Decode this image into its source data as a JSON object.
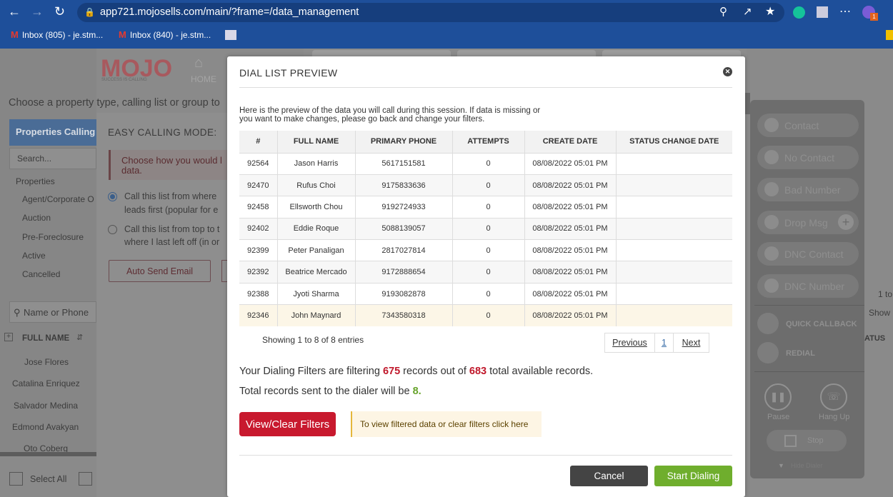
{
  "browser": {
    "url": "app721.mojosells.com/main/?frame=/data_management",
    "bookmarks": [
      {
        "label": "Inbox (805) - je.stm..."
      },
      {
        "label": "Inbox (840) - je.stm..."
      }
    ]
  },
  "background": {
    "brand": "MOJO",
    "brand_tagline": "SUCCESS IS CALLING",
    "home_label": "HOME",
    "choose_text": "Choose a property type, calling list or group to",
    "sidebar_title": "Properties Calling",
    "search_placeholder": "Search...",
    "properties_label": "Properties",
    "property_items": [
      "Agent/Corporate O",
      "Auction",
      "Pre-Foreclosure",
      "Active",
      "Cancelled"
    ],
    "name_phone_placeholder": "Name or Phone",
    "full_name_header": "FULL NAME",
    "names": [
      "Jose Flores",
      "Catalina Enriquez",
      "Salvador Medina",
      "Edmond Avakyan",
      "Oto Coberg"
    ],
    "select_all": "Select All",
    "easy_calling_title": "EASY CALLING MODE:",
    "choose_how": "Choose how you would l",
    "choose_how2": "data.",
    "option1a": "Call this list from where",
    "option1b": "leads first (popular for e",
    "option2a": "Call this list from top to t",
    "option2b": "where I last left off (in or",
    "auto_send_email": "Auto Send Email",
    "right_partial_1": "1 to",
    "right_partial_2": "Show",
    "right_partial_3": "ATUS"
  },
  "dialer": {
    "buttons": [
      "Contact",
      "No Contact",
      "Bad Number",
      "Drop Msg",
      "DNC Contact",
      "DNC Number"
    ],
    "quick_callback": "QUICK CALLBACK",
    "redial": "REDIAL",
    "pause": "Pause",
    "hang_up": "Hang Up",
    "stop": "Stop",
    "hide_dialer": "Hide Dialer"
  },
  "modal": {
    "title": "DIAL LIST PREVIEW",
    "intro": "Here is the preview of the data you will call during this session. If data is missing or you want to make changes, please go back and change your filters.",
    "columns": [
      "#",
      "FULL NAME",
      "PRIMARY PHONE",
      "ATTEMPTS",
      "CREATE DATE",
      "STATUS CHANGE DATE"
    ],
    "rows": [
      [
        "92564",
        "Jason Harris",
        "5617151581",
        "0",
        "08/08/2022 05:01 PM",
        ""
      ],
      [
        "92470",
        "Rufus Choi",
        "9175833636",
        "0",
        "08/08/2022 05:01 PM",
        ""
      ],
      [
        "92458",
        "Ellsworth Chou",
        "9192724933",
        "0",
        "08/08/2022 05:01 PM",
        ""
      ],
      [
        "92402",
        "Eddie Roque",
        "5088139057",
        "0",
        "08/08/2022 05:01 PM",
        ""
      ],
      [
        "92399",
        "Peter Panaligan",
        "2817027814",
        "0",
        "08/08/2022 05:01 PM",
        ""
      ],
      [
        "92392",
        "Beatrice Mercado",
        "9172888654",
        "0",
        "08/08/2022 05:01 PM",
        ""
      ],
      [
        "92388",
        "Jyoti Sharma",
        "9193082878",
        "0",
        "08/08/2022 05:01 PM",
        ""
      ],
      [
        "92346",
        "John Maynard",
        "7343580318",
        "0",
        "08/08/2022 05:01 PM",
        ""
      ]
    ],
    "showing": "Showing 1 to 8 of 8 entries",
    "pager": {
      "previous": "Previous",
      "page": "1",
      "next": "Next"
    },
    "filter_text_a": "Your Dialing Filters are filtering ",
    "filtered_count": "675",
    "filter_text_b": " records out of ",
    "total_count": "683",
    "filter_text_c": " total available records.",
    "sent_text_a": "Total records sent to the dialer will be ",
    "sent_count": "8",
    "sent_text_b": ".",
    "view_clear_label": "View/Clear Filters",
    "hint": "To view filtered data or clear filters click here",
    "cancel_label": "Cancel",
    "start_label": "Start Dialing"
  }
}
